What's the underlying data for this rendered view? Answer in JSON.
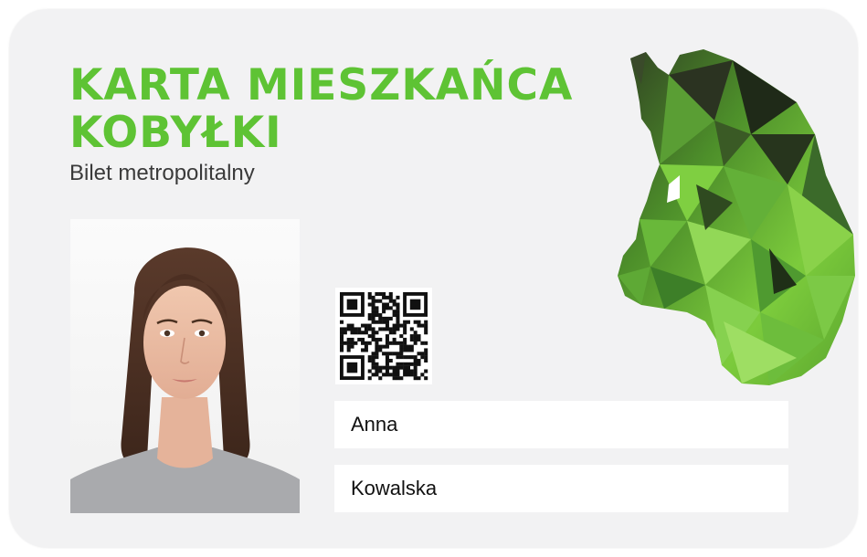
{
  "card": {
    "title_line1": "KARTA MIESZKAŃCA",
    "title_line2": "KOBYŁKI",
    "subtitle": "Bilet metropolitalny",
    "first_name": "Anna",
    "last_name": "Kowalska"
  },
  "colors": {
    "brand_green": "#5ec334",
    "card_background": "#f2f2f3",
    "field_background": "#ffffff",
    "text_dark": "#111111"
  },
  "icons": {
    "qr": "qr-code-icon",
    "emblem": "horse-head-emblem-icon",
    "photo": "person-photo-icon"
  }
}
